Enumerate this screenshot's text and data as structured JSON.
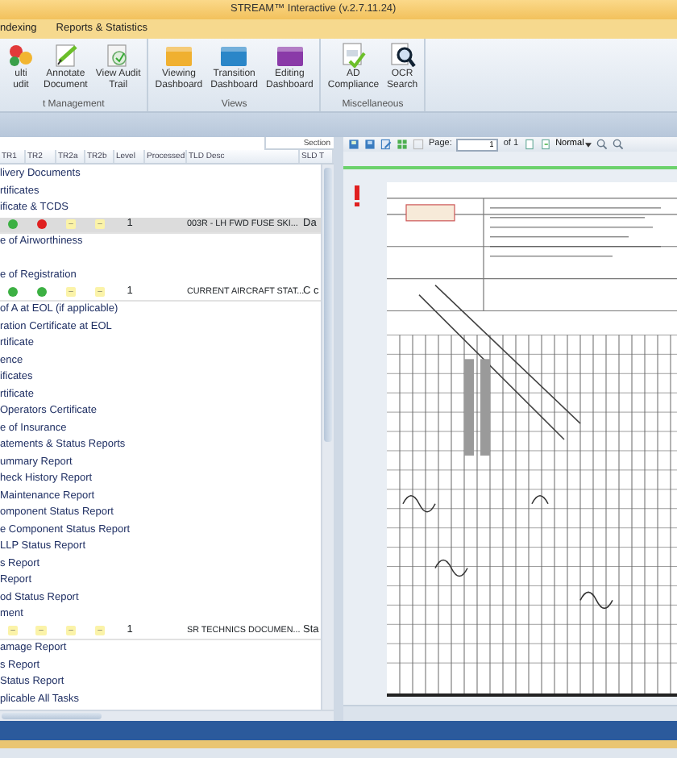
{
  "window": {
    "title": "STREAM™ Interactive (v.2.7.11.24)"
  },
  "ribbon_tabs": [
    {
      "label": "ndexing"
    },
    {
      "label": "Reports & Statistics"
    }
  ],
  "ribbon_groups": [
    {
      "label": "t Management",
      "buttons": [
        {
          "kind": "audit",
          "lines": [
            "ulti",
            "udit"
          ]
        },
        {
          "kind": "annotate",
          "lines": [
            "Annotate",
            "Document"
          ]
        },
        {
          "kind": "trail",
          "lines": [
            "View Audit",
            "Trail"
          ]
        }
      ]
    },
    {
      "label": "Views",
      "buttons": [
        {
          "kind": "dashboard",
          "color": "#f0b030",
          "lines": [
            "Viewing",
            "Dashboard"
          ]
        },
        {
          "kind": "dashboard",
          "color": "#2a86c8",
          "lines": [
            "Transition",
            "Dashboard"
          ]
        },
        {
          "kind": "dashboard",
          "color": "#8a3aa8",
          "lines": [
            "Editing",
            "Dashboard"
          ]
        }
      ]
    },
    {
      "label": "Miscellaneous",
      "buttons": [
        {
          "kind": "ad",
          "lines": [
            "AD",
            "Compliance"
          ]
        },
        {
          "kind": "ocr",
          "lines": [
            "OCR",
            "Search"
          ]
        }
      ]
    }
  ],
  "left_panel": {
    "section_label": "Section",
    "columns": [
      "TR1",
      "TR2",
      "TR2a",
      "TR2b",
      "Level",
      "Processed",
      "TLD Desc",
      "SLD T"
    ],
    "rows": [
      {
        "kind": "group",
        "label": "livery Documents",
        "selected": false
      },
      {
        "kind": "group",
        "label": "rtificates",
        "selected": false
      },
      {
        "kind": "group",
        "label": "ificate & TCDS",
        "selected": false
      },
      {
        "kind": "data",
        "selected": true,
        "status": [
          {
            "kind": "dot",
            "color": "#3cb043"
          },
          {
            "kind": "dot",
            "color": "#e02020"
          },
          {
            "kind": "dash",
            "label": "–"
          },
          {
            "kind": "dash",
            "label": "–"
          }
        ],
        "level": "1",
        "desc": "003R - LH FWD FUSE SKI...",
        "sld": "Da"
      },
      {
        "kind": "group",
        "label": "e of Airworthiness",
        "selected": false
      },
      {
        "kind": "blank",
        "selected": false
      },
      {
        "kind": "group",
        "label": "e of Registration",
        "selected": false
      },
      {
        "kind": "data",
        "selected": false,
        "status": [
          {
            "kind": "dot",
            "color": "#3cb043"
          },
          {
            "kind": "dot",
            "color": "#3cb043"
          },
          {
            "kind": "dash",
            "label": "–"
          },
          {
            "kind": "dash",
            "label": "–"
          }
        ],
        "level": "1",
        "desc": "CURRENT AIRCRAFT STAT...",
        "sld": "C c"
      },
      {
        "kind": "group",
        "label": "of A at EOL (if applicable)",
        "selected": false
      },
      {
        "kind": "group",
        "label": "ration Certificate at EOL",
        "selected": false
      },
      {
        "kind": "group",
        "label": "rtificate",
        "selected": false
      },
      {
        "kind": "group",
        "label": "ence",
        "selected": false
      },
      {
        "kind": "group",
        "label": "ificates",
        "selected": false
      },
      {
        "kind": "group",
        "label": "rtificate",
        "selected": false
      },
      {
        "kind": "group",
        "label": "Operators Certificate",
        "selected": false
      },
      {
        "kind": "group",
        "label": "e of Insurance",
        "selected": false
      },
      {
        "kind": "group",
        "label": "atements & Status Reports",
        "selected": false
      },
      {
        "kind": "group",
        "label": "ummary Report",
        "selected": false
      },
      {
        "kind": "group",
        "label": "heck History Report",
        "selected": false
      },
      {
        "kind": "group",
        "label": "Maintenance Report",
        "selected": false
      },
      {
        "kind": "group",
        "label": "omponent Status Report",
        "selected": false
      },
      {
        "kind": "group",
        "label": "e Component Status Report",
        "selected": false
      },
      {
        "kind": "group",
        "label": "LLP Status Report",
        "selected": false
      },
      {
        "kind": "group",
        "label": "s Report",
        "selected": false
      },
      {
        "kind": "group",
        "label": "Report",
        "selected": false
      },
      {
        "kind": "group",
        "label": "od Status Report",
        "selected": false
      },
      {
        "kind": "group",
        "label": "ment",
        "selected": false
      },
      {
        "kind": "data",
        "selected": false,
        "status": [
          {
            "kind": "dash",
            "label": "–"
          },
          {
            "kind": "dash",
            "label": "–"
          },
          {
            "kind": "dash",
            "label": "–"
          },
          {
            "kind": "dash",
            "label": "–"
          }
        ],
        "level": "1",
        "desc": "SR TECHNICS DOCUMEN...",
        "sld": "Sta"
      },
      {
        "kind": "group",
        "label": "amage Report",
        "selected": false
      },
      {
        "kind": "group",
        "label": "s Report",
        "selected": false
      },
      {
        "kind": "group",
        "label": "Status Report",
        "selected": false
      },
      {
        "kind": "group",
        "label": "plicable All Tasks",
        "selected": false
      }
    ]
  },
  "viewer_toolbar": {
    "page_label": "Page:",
    "page_value": "1",
    "page_total": "of 1",
    "zoom_mode": "Normal"
  },
  "viewer": {
    "alert": true
  }
}
